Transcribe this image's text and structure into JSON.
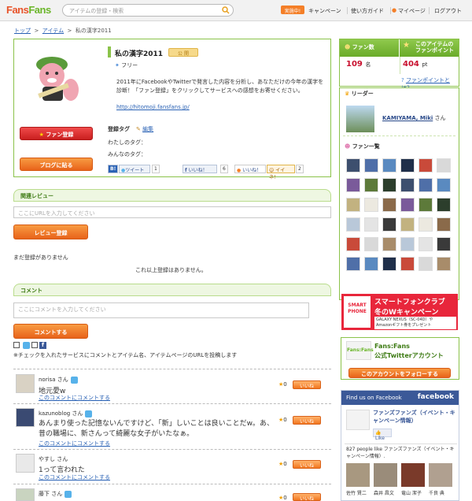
{
  "header": {
    "logo_main": "Fans",
    "logo_accent": "Fans",
    "search_placeholder": "アイテムの登録・検索",
    "badge": "実施中!",
    "nav": [
      "キャンペーン",
      "使い方ガイド",
      "マイページ",
      "ログアウト"
    ]
  },
  "breadcrumb": {
    "top": "トップ",
    "item": "アイテム",
    "current": "私の漢字2011",
    "sep": ">"
  },
  "item": {
    "title": "私の漢字2011",
    "badge": "公 開",
    "category": "フリー",
    "description": "2011年にFacebookやTwitterで発言した内容を分析し、あなただけの今年の漢字を診断！「ファン登録」をクリックしてサービスへの感想をお寄せください。",
    "url": "http://hitomoji.fansfans.jp/",
    "tags_label": "登録タグ",
    "edit_label": "編集",
    "my_tags": "わたしのタグ：",
    "all_tags": "みんなのタグ：",
    "fan_button": "ファン登録",
    "blog_button": "ブログに貼る",
    "social": [
      {
        "label": "B!",
        "count": ""
      },
      {
        "label": "ツイート",
        "count": "1"
      },
      {
        "label": "いいね！",
        "count": "6"
      },
      {
        "label": "いいね！",
        "count": ""
      },
      {
        "label": "イイネ！",
        "count": "2"
      }
    ]
  },
  "review": {
    "heading": "関連レビュー",
    "placeholder": "ここにURLを入力してください",
    "button": "レビュー登録",
    "none_yet": "まだ登録がありません",
    "no_more": "これ以上登録はありません。"
  },
  "comment": {
    "heading": "コメント",
    "placeholder": "ここにコメントを入力してください",
    "button": "コメントする",
    "notice": "※チェックを入れたサービスにコメントとアイテム名、アイテムページのURLを投稿します",
    "like_label": "いいね",
    "reply_label": "このコメントにコメントする",
    "list": [
      {
        "name": "norisa",
        "suffix": "さん",
        "body": "地元愛w",
        "likes": "0"
      },
      {
        "name": "kazunoblog",
        "suffix": "さん",
        "body": "あんまり使った記憶ないんですけど、「新」しいことは良いことだw。あ、昔の職場に、新さんって綺麗な女子がいたなぁ。",
        "likes": "0"
      },
      {
        "name": "やすし",
        "suffix": "さん",
        "body": "1って言われた",
        "likes": "0"
      },
      {
        "name": "藤下",
        "suffix": "さん",
        "body": "",
        "likes": "0"
      }
    ]
  },
  "sidebar": {
    "fans_label": "ファン数",
    "fans_value": "109",
    "fans_unit": "名",
    "points_label_1": "このアイテムの",
    "points_label_2": "ファンポイント",
    "points_value": "404",
    "points_unit": "pt",
    "points_link": "ファンポイントとは？",
    "leader_label": "リーダー",
    "leader_name": "KAMIYAMA, Miki",
    "leader_suffix": "さん",
    "fan_list_label": "ファン一覧",
    "ad_title": "スマートフォンクラブ",
    "ad_sub": "冬のWキャンペーン",
    "ad_detail1": "GALAXY NEXUS（SC-04D）や",
    "ad_detail2": "Amazonギフト券をプレゼント",
    "ad_logo": "SMART PHONE",
    "tw_title1": "Fans:Fans",
    "tw_title2": "公式Twitterアカウント",
    "tw_button": "このアカウントをフォローする",
    "fb_find": "Find us on Facebook",
    "fb_brand": "facebook",
    "fb_page": "ファンズファンズ（イベント・キャンペーン情報）",
    "fb_like": "Like",
    "fb_count": "827 people like ファンズファンズ（イベント・キャンペーン情報）.",
    "fb_people": [
      "佐竹 賢二",
      "森井 昌文",
      "竜山 潔子",
      "千良 典"
    ]
  },
  "colors": {
    "green": "#8bc34a",
    "orange": "#f2761f",
    "red": "#e8263b",
    "link": "#2a62b5"
  }
}
